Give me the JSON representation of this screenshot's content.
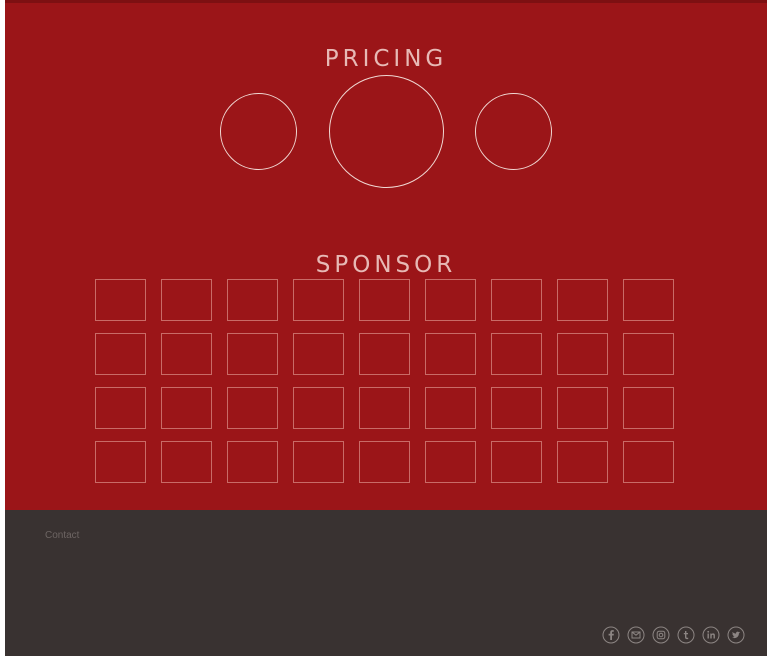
{
  "pricing": {
    "title": "PRICING",
    "plans": [
      "plan-1",
      "plan-2",
      "plan-3"
    ]
  },
  "sponsor": {
    "title": "SPONSOR",
    "rows": 4,
    "columns": 9
  },
  "footer": {
    "contact_label": "Contact",
    "social_icons": [
      "facebook-icon",
      "email-icon",
      "instagram-icon",
      "tumblr-icon",
      "linkedin-icon",
      "twitter-icon"
    ]
  },
  "colors": {
    "red_background": "#9b1518",
    "footer_background": "#393231",
    "title_text": "#e7b9b5",
    "circle_outline": "#f0d7d2",
    "grid_outline": "#c96b67",
    "footer_text": "#6d6563"
  }
}
